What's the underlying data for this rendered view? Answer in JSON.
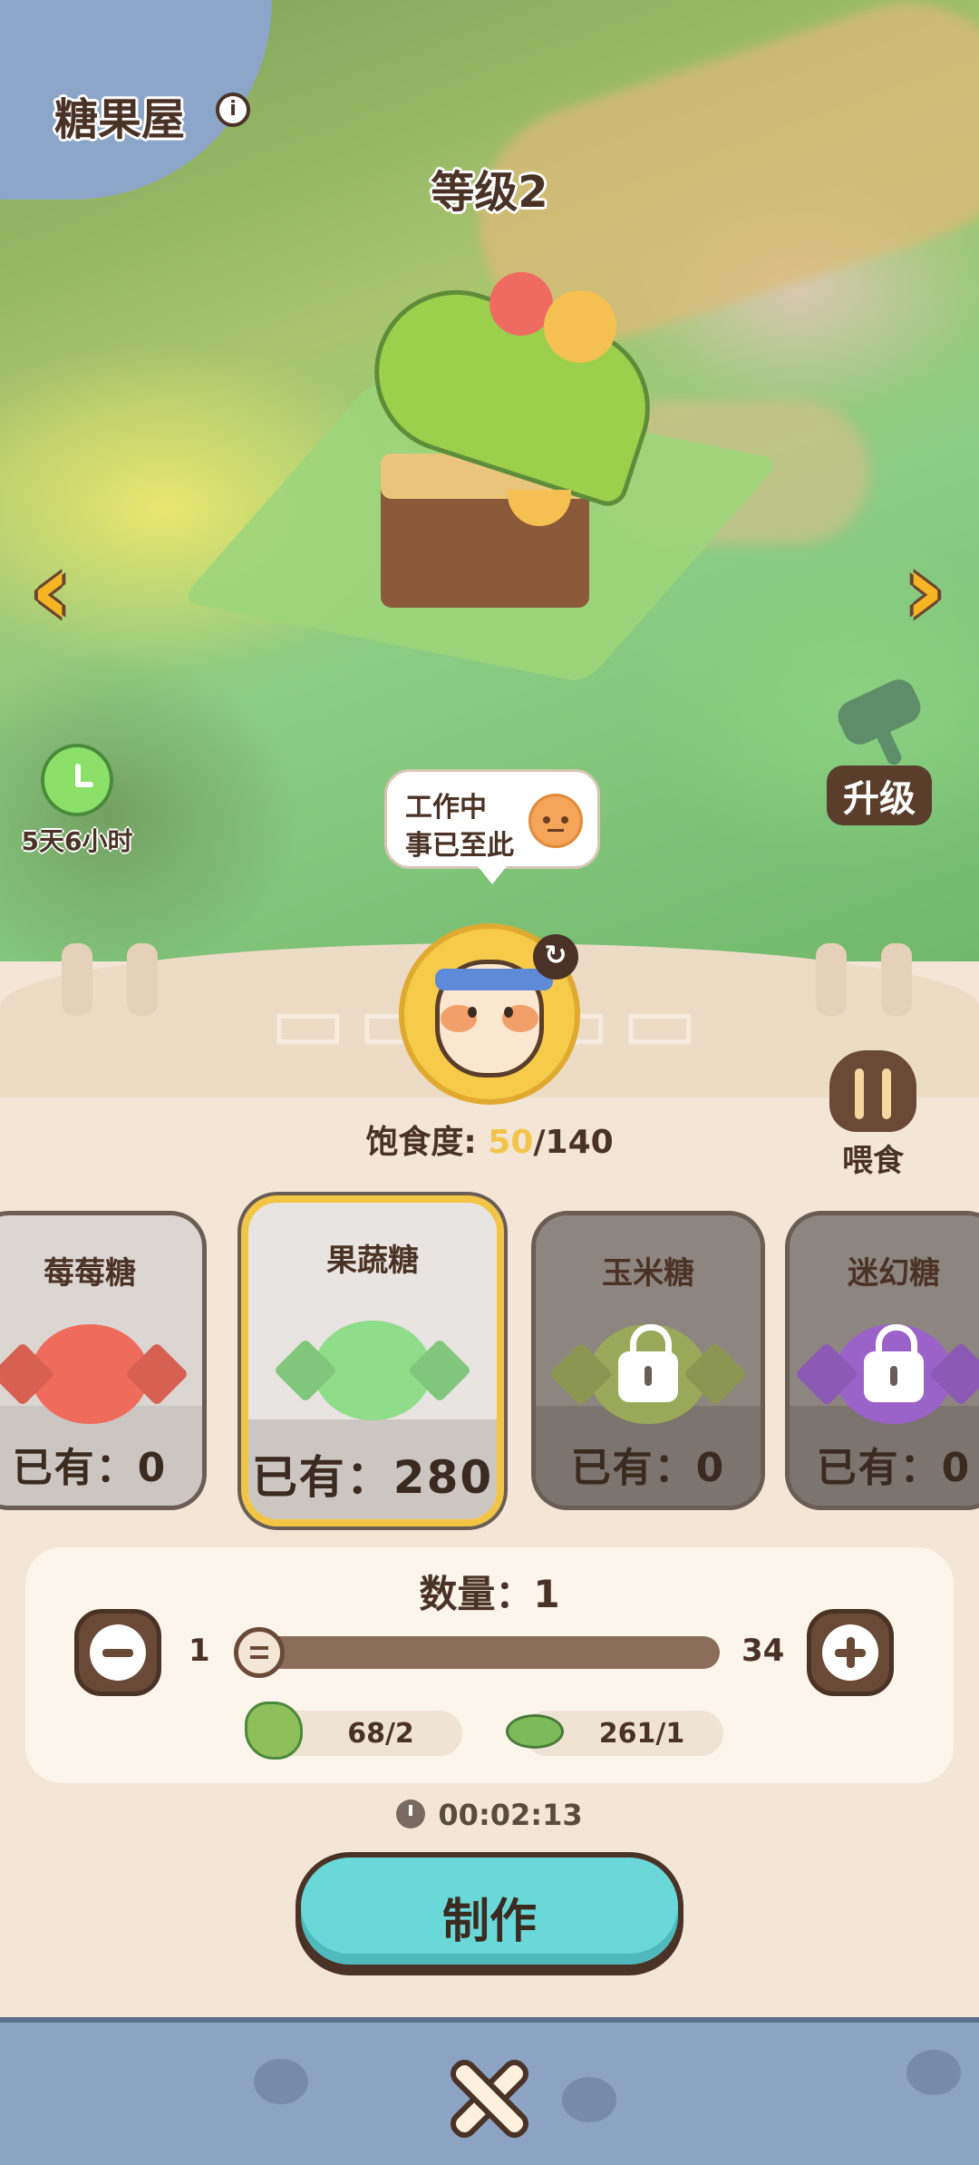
{
  "header": {
    "title": "糖果屋",
    "info_icon": "i",
    "level": "等级2"
  },
  "timer": {
    "label": "5天6小时"
  },
  "upgrade": {
    "label": "升级"
  },
  "bubble": {
    "line1": "工作中",
    "line2": "事已至此"
  },
  "pet": {
    "satiety_label": "饱食度: ",
    "satiety_current": "50",
    "satiety_max": "/140"
  },
  "feed": {
    "label": "喂食"
  },
  "candies": [
    {
      "name": "莓莓糖",
      "owned": "已有：0",
      "locked": false,
      "color": "#ef6b5c"
    },
    {
      "name": "果蔬糖",
      "owned": "已有：280",
      "locked": false,
      "selected": true,
      "color": "#8fdc8a"
    },
    {
      "name": "玉米糖",
      "owned": "已有：0",
      "locked": true,
      "color": "#9aa85a"
    },
    {
      "name": "迷幻糖",
      "owned": "已有：0",
      "locked": true,
      "color": "#9b63c9"
    }
  ],
  "quantity": {
    "label": "数量：1",
    "min": "1",
    "max": "34",
    "value": 1
  },
  "materials": [
    {
      "icon": "lettuce-icon",
      "value": "68/2"
    },
    {
      "icon": "leaf-icon",
      "value": "261/1"
    }
  ],
  "craft_time": "00:02:13",
  "make_button": "制作",
  "colors": {
    "accent": "#6ad8d8",
    "panel": "#f3e6d6",
    "bottom_bar": "#8ca3c4",
    "arrow": "#f5b524"
  }
}
